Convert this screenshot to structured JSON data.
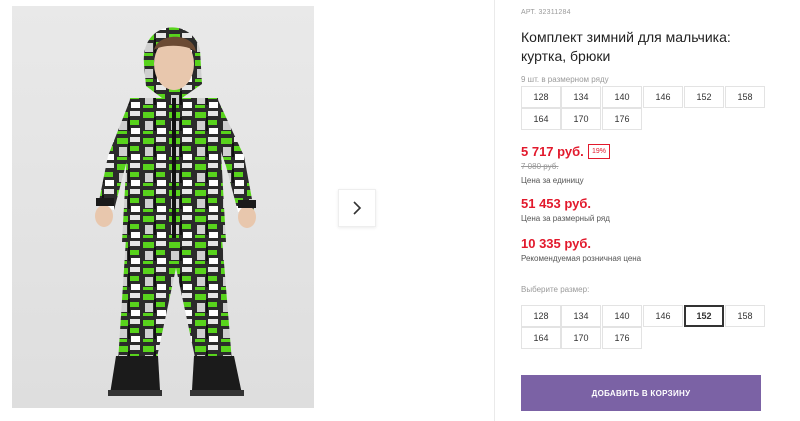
{
  "gallery": {
    "image_alt": "Boy wearing a winter jacket and trousers set with black, white and green print",
    "next_icon": "chevron-right-icon"
  },
  "product": {
    "sku_label": "АРТ.",
    "sku": "32311284",
    "title": "Комплект зимний для мальчика: куртка, брюки",
    "in_row_label": "9 шт. в размерном ряду",
    "row_sizes": [
      "128",
      "134",
      "140",
      "146",
      "152",
      "158",
      "164",
      "170",
      "176"
    ]
  },
  "pricing": {
    "unit_price": "5 717 руб.",
    "discount": "19%",
    "old_price": "7 080 руб.",
    "unit_label": "Цена за единицу",
    "row_price": "51 453 руб.",
    "row_label": "Цена за размерный ряд",
    "rrp_price": "10 335 руб.",
    "rrp_label": "Рекомендуемая розничная цена"
  },
  "size_picker": {
    "label": "Выберите размер:",
    "sizes": [
      "128",
      "134",
      "140",
      "146",
      "152",
      "158",
      "164",
      "170",
      "176"
    ],
    "selected": "152"
  },
  "cart": {
    "add_label": "ДОБАВИТЬ В КОРЗИНУ"
  },
  "colors": {
    "price": "#e2192c",
    "button": "#7b62a5",
    "print_green": "#58d31c"
  }
}
